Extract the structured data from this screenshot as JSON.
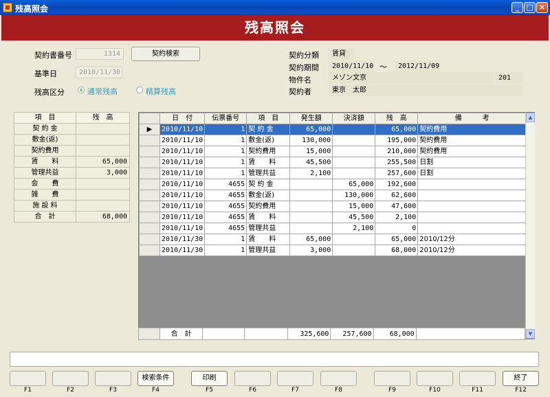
{
  "window": {
    "title": "残高照会"
  },
  "banner": "残高照会",
  "form": {
    "contract_no_label": "契約書番号",
    "contract_no_value": "1314",
    "contract_search_label": "契約検索",
    "base_date_label": "基準日",
    "base_date_value": "2010/11/30",
    "balance_type_label": "残高区分",
    "radio_normal": "通常残高",
    "radio_settle": "精算残高",
    "contract_class_label": "契約分類",
    "contract_class_value": "賃貸",
    "period_label": "契約期間",
    "period_from": "2010/11/10",
    "period_sep": "～",
    "period_to": "2012/11/09",
    "property_label": "物件名",
    "property_value": "メゾン文京",
    "room_value": "201",
    "contractor_label": "契約者",
    "contractor_value": "東京　太郎"
  },
  "summary": {
    "headers": [
      "項　目",
      "残　高"
    ],
    "rows": [
      {
        "item": "契 約 金",
        "balance": ""
      },
      {
        "item": "敷金(返)",
        "balance": ""
      },
      {
        "item": "契約費用",
        "balance": ""
      },
      {
        "item": "賃　　料",
        "balance": "65,000"
      },
      {
        "item": "管理共益",
        "balance": "3,000"
      },
      {
        "item": "会　　費",
        "balance": ""
      },
      {
        "item": "雑　　費",
        "balance": ""
      },
      {
        "item": "施 設 料",
        "balance": ""
      },
      {
        "item": "合　計",
        "balance": "68,000"
      }
    ]
  },
  "grid": {
    "headers": [
      "日　付",
      "伝票番号",
      "項　目",
      "発生額",
      "決済額",
      "残　高",
      "備　　　考"
    ],
    "rows": [
      [
        "2010/11/10",
        "1",
        "契 約 金",
        "65,000",
        "",
        "65,000",
        "契約費用"
      ],
      [
        "2010/11/10",
        "1",
        "敷金(返)",
        "130,000",
        "",
        "195,000",
        "契約費用"
      ],
      [
        "2010/11/10",
        "1",
        "契約費用",
        "15,000",
        "",
        "210,000",
        "契約費用"
      ],
      [
        "2010/11/10",
        "1",
        "賃　　料",
        "45,500",
        "",
        "255,500",
        "日割"
      ],
      [
        "2010/11/10",
        "1",
        "管理共益",
        "2,100",
        "",
        "257,600",
        "日割"
      ],
      [
        "2010/11/10",
        "4655",
        "契 約 金",
        "",
        "65,000",
        "192,600",
        ""
      ],
      [
        "2010/11/10",
        "4655",
        "敷金(返)",
        "",
        "130,000",
        "62,600",
        ""
      ],
      [
        "2010/11/10",
        "4655",
        "契約費用",
        "",
        "15,000",
        "47,600",
        ""
      ],
      [
        "2010/11/10",
        "4655",
        "賃　　料",
        "",
        "45,500",
        "2,100",
        ""
      ],
      [
        "2010/11/10",
        "4655",
        "管理共益",
        "",
        "2,100",
        "0",
        ""
      ],
      [
        "2010/11/30",
        "1",
        "賃　　料",
        "65,000",
        "",
        "65,000",
        "2010/12分"
      ],
      [
        "2010/11/30",
        "1",
        "管理共益",
        "3,000",
        "",
        "68,000",
        "2010/12分"
      ]
    ],
    "total": {
      "label": "合　計",
      "occurred": "325,600",
      "settled": "257,600",
      "balance": "68,000"
    }
  },
  "fkeys": [
    {
      "key": "F1",
      "label": ""
    },
    {
      "key": "F2",
      "label": ""
    },
    {
      "key": "F3",
      "label": ""
    },
    {
      "key": "F4",
      "label": "検索条件"
    },
    {
      "key": "F5",
      "label": "印刷"
    },
    {
      "key": "F6",
      "label": ""
    },
    {
      "key": "F7",
      "label": ""
    },
    {
      "key": "F8",
      "label": ""
    },
    {
      "key": "F9",
      "label": ""
    },
    {
      "key": "F10",
      "label": ""
    },
    {
      "key": "F11",
      "label": ""
    },
    {
      "key": "F12",
      "label": "終了"
    }
  ]
}
